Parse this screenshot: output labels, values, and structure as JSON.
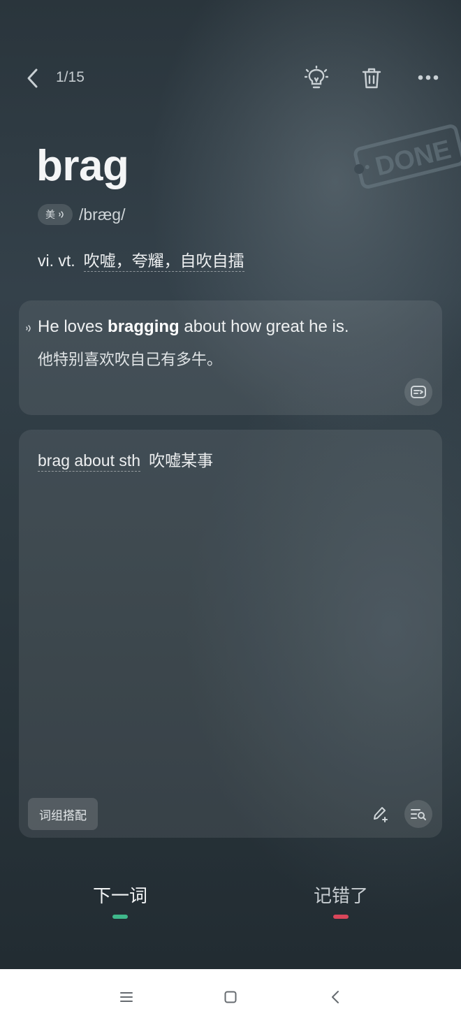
{
  "header": {
    "count": "1/15",
    "icons": [
      "back-icon",
      "lightbulb-icon",
      "trash-icon",
      "more-icon"
    ]
  },
  "stamp": {
    "text": "DONE"
  },
  "word": {
    "headword": "brag",
    "region": "美",
    "phonetic": "/bræg/",
    "pos": "vi. vt.",
    "meaning": "吹嘘，夸耀，自吹自擂"
  },
  "example": {
    "en_before": "He loves ",
    "en_bold": "bragging",
    "en_after": " about how great he is.",
    "zh": "他特别喜欢吹自己有多牛。"
  },
  "phrase": {
    "en": "brag about sth",
    "zh": "吹嘘某事",
    "tag_label": "词组搭配"
  },
  "actions": {
    "next_label": "下一词",
    "wrong_label": "记错了",
    "next_color": "#3fb88b",
    "wrong_color": "#d9465a"
  },
  "navbar": {
    "icons": [
      "menu-icon",
      "home-icon",
      "nav-back-icon"
    ]
  }
}
